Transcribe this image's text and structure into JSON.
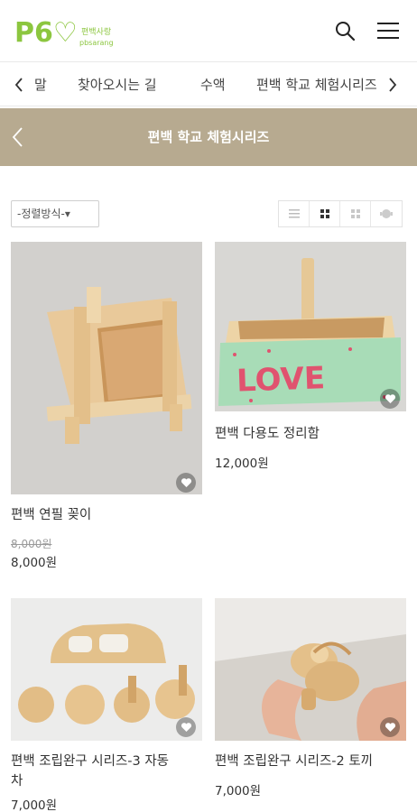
{
  "header": {
    "logo_text": "P6♡",
    "logo_sub_kr": "편백사랑",
    "logo_sub_en": "pbsarang"
  },
  "category_nav": {
    "items": [
      "말",
      "찾아오시는 길",
      "수액",
      "편백 학교 체험시리즈"
    ]
  },
  "page": {
    "title": "편백 학교 체험시리즈"
  },
  "toolbar": {
    "sort_label": "-정렬방식-▾"
  },
  "products": [
    {
      "name": "편백 연필 꽂이",
      "original_price": "8,000원",
      "price": "8,000원"
    },
    {
      "name": "편백 다용도 정리함",
      "price": "12,000원",
      "image_text": "LOVE"
    },
    {
      "name": "편백 조립완구 시리즈-3 자동차",
      "name_line1": "편백 조립완구 시리즈-3 자동",
      "name_line2": "차",
      "price": "7,000원"
    },
    {
      "name": "편백 조립완구 시리즈-2 토끼",
      "price": "7,000원"
    }
  ],
  "colors": {
    "brand_green": "#8cc63f",
    "title_bar": "#b7aa90"
  }
}
